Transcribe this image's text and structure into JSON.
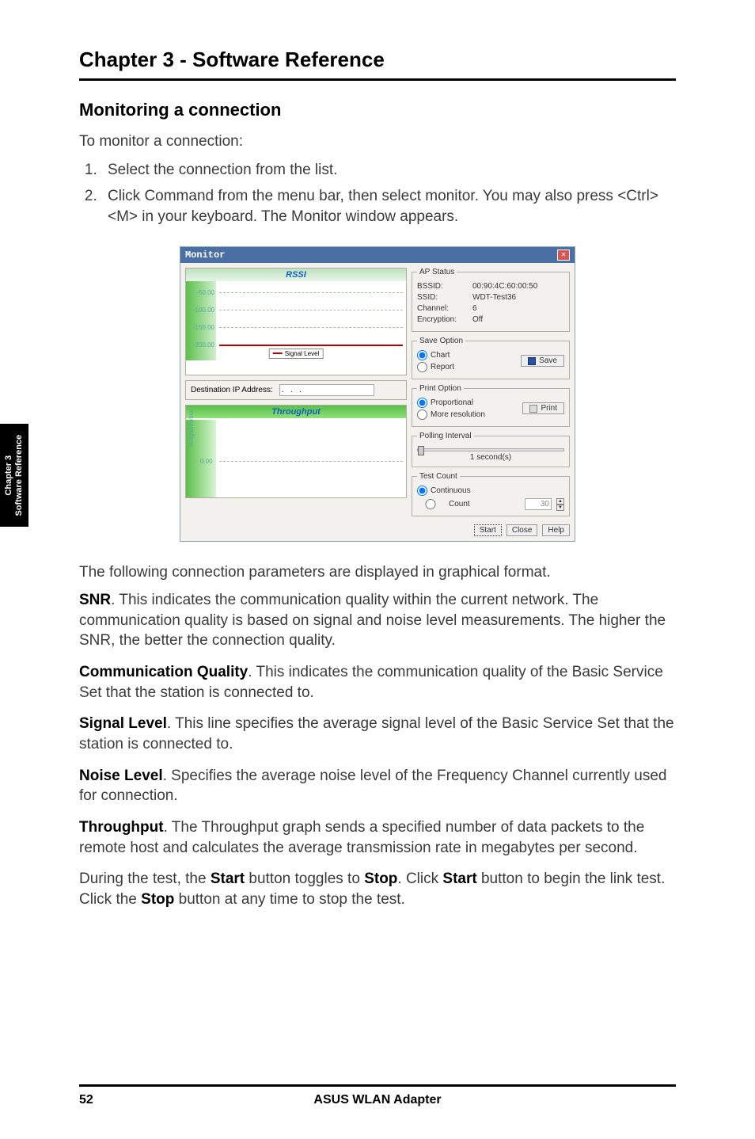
{
  "header": {
    "chapter_title": "Chapter 3 - Software Reference"
  },
  "section": {
    "title": "Monitoring a connection"
  },
  "intro": "To monitor a connection:",
  "steps": [
    "Select the connection from the list.",
    "Click Command from the menu bar, then select monitor. You may also press <Ctrl> <M> in your keyboard. The Monitor window appears."
  ],
  "side_tab": {
    "line1": "Chapter 3",
    "line2": "Software Reference"
  },
  "monitor": {
    "title": "Monitor",
    "rssi_label": "RSSI",
    "rssi_ticks": [
      "-50.00",
      "-100.00",
      "-150.00",
      "-200.00"
    ],
    "legend": "Signal Level",
    "dest_label": "Destination IP Address:",
    "dest_value": ".   .   .",
    "throughput_label": "Throughput",
    "tp_axis": "megabits/sec",
    "tp_tick": "0.00",
    "ap_status": {
      "legend": "AP Status",
      "bssid_k": "BSSID:",
      "bssid_v": "00:90:4C:60:00:50",
      "ssid_k": "SSID:",
      "ssid_v": "WDT-Test36",
      "channel_k": "Channel:",
      "channel_v": "6",
      "enc_k": "Encryption:",
      "enc_v": "Off"
    },
    "save_option": {
      "legend": "Save Option",
      "chart": "Chart",
      "report": "Report",
      "save_btn": "Save"
    },
    "print_option": {
      "legend": "Print Option",
      "proportional": "Proportional",
      "more": "More resolution",
      "print_btn": "Print"
    },
    "polling": {
      "legend": "Polling Interval",
      "value": "1 second(s)"
    },
    "test_count": {
      "legend": "Test Count",
      "continuous": "Continuous",
      "count": "Count",
      "count_value": "30"
    },
    "buttons": {
      "start": "Start",
      "close": "Close",
      "help": "Help"
    }
  },
  "post_text": "The following connection parameters are displayed in graphical format.",
  "paras": {
    "snr_lead": "SNR",
    "snr_body": ". This indicates the communication quality within the current network. The communication quality is based on signal and noise level measurements. The higher the SNR, the better the connection quality.",
    "cq_lead": "Communication Quality",
    "cq_body": ". This indicates the communication quality of the Basic Service Set that the station is connected to.",
    "sl_lead": "Signal Level",
    "sl_body": ". This line specifies the average signal level of the Basic Service Set that the station is connected to.",
    "nl_lead": "Noise Level",
    "nl_body": ". Specifies the average noise level of the Frequency Channel currently used for connection.",
    "tp_lead": "Throughput",
    "tp_body": ". The Throughput graph sends a specified number of data packets to the remote host and calculates the average transmission rate in megabytes per second.",
    "last_pre": "During the test, the ",
    "last_start": "Start",
    "last_mid1": " button toggles to ",
    "last_stop": "Stop",
    "last_mid2": ". Click ",
    "last_start2": "Start",
    "last_mid3": " button to begin the link test. Click the ",
    "last_stopbtn": "Stop",
    "last_end": " button at any time to stop the test."
  },
  "footer": {
    "page": "52",
    "center": "ASUS WLAN Adapter"
  }
}
